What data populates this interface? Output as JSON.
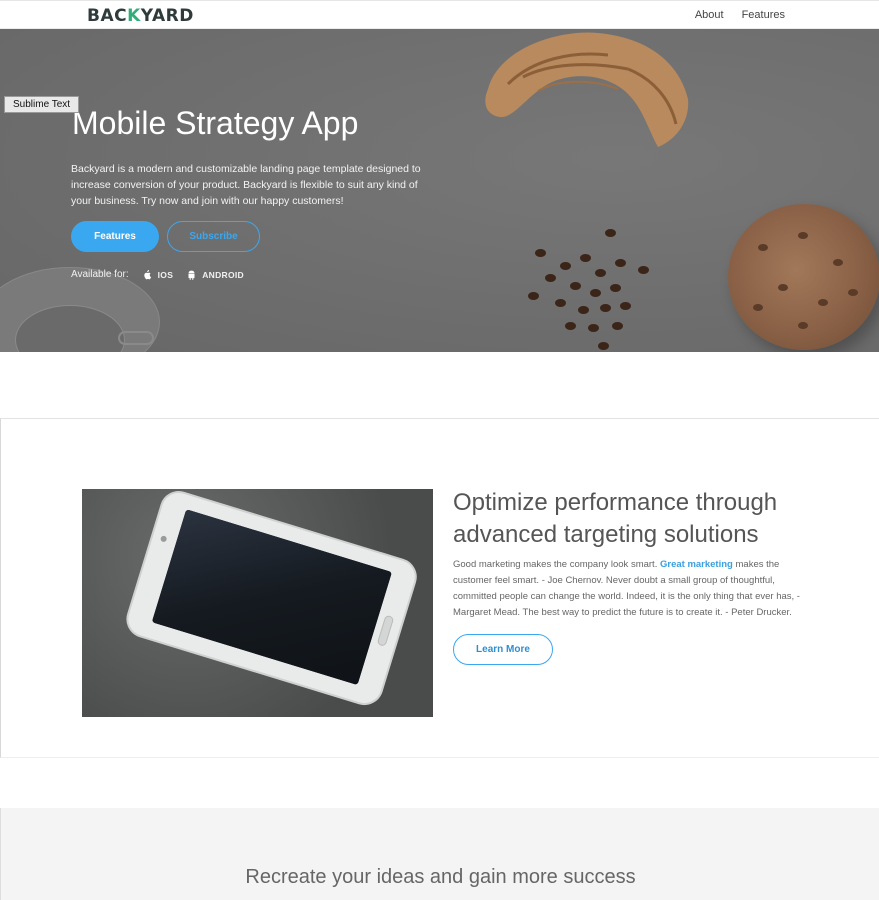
{
  "nav": {
    "logo_part1": "BAC",
    "logo_part2": "K",
    "logo_part3": "YARD",
    "links": [
      "About",
      "Features"
    ]
  },
  "tooltip": "Sublime Text",
  "hero": {
    "title": "Mobile Strategy App",
    "description": "Backyard is a modern and customizable landing page template designed to increase conversion of your product. Backyard is flexible to suit any kind of your business. Try now and join with our happy customers!",
    "primary_button": "Features",
    "secondary_button": "Subscribe",
    "available_label": "Available for:",
    "platforms": [
      "IOS",
      "ANDROID"
    ],
    "background_color": "#6f6f6f",
    "accent_color": "#3aa8f0"
  },
  "feature": {
    "title": "Optimize performance through advanced targeting solutions",
    "text_before": "Good marketing makes the company look smart. ",
    "text_highlight": "Great marketing",
    "text_after": " makes the customer feel smart. - Joe Chernov. Never doubt a small group of thoughtful, committed people can change the world. Indeed, it is the only thing that ever has, - Margaret Mead. The best way to predict the future is to create it. - Peter Drucker.",
    "button": "Learn More"
  },
  "section3": {
    "title": "Recreate your ideas and gain more success"
  }
}
